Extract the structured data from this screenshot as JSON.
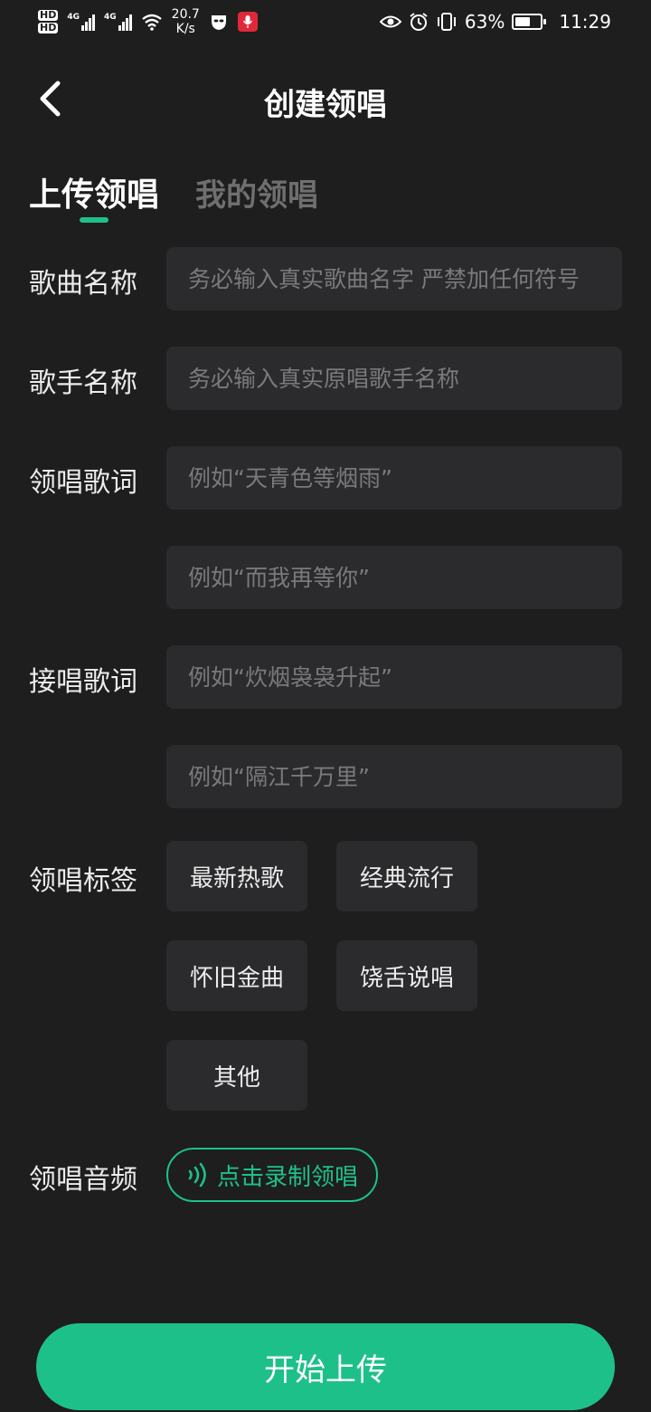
{
  "status_bar": {
    "hd1": "HD",
    "hd2": "HD",
    "signal1_label": "4G",
    "signal2_label": "4G",
    "net_speed": "20.7",
    "net_unit": "K/s",
    "battery_percent": "63%",
    "battery_level": 0.63,
    "time": "11:29"
  },
  "header": {
    "title": "创建领唱"
  },
  "tabs": [
    {
      "label": "上传领唱",
      "active": true
    },
    {
      "label": "我的领唱",
      "active": false
    }
  ],
  "form": {
    "song_name": {
      "label": "歌曲名称",
      "placeholder": "务必输入真实歌曲名字 严禁加任何符号",
      "value": ""
    },
    "singer_name": {
      "label": "歌手名称",
      "placeholder": "务必输入真实原唱歌手名称",
      "value": ""
    },
    "lead_lyrics": {
      "label": "领唱歌词",
      "placeholder1": "例如“天青色等烟雨”",
      "placeholder2": "例如“而我再等你”"
    },
    "follow_lyrics": {
      "label": "接唱歌词",
      "placeholder1": "例如“炊烟袅袅升起”",
      "placeholder2": "例如“隔江千万里”"
    },
    "tags": {
      "label": "领唱标签",
      "items": [
        "最新热歌",
        "经典流行",
        "怀旧金曲",
        "饶舌说唱",
        "其他"
      ]
    },
    "audio": {
      "label": "领唱音频",
      "button": "点击录制领唱"
    }
  },
  "upload_button": "开始上传",
  "colors": {
    "accent": "#1ec089",
    "background": "#1e1e1f",
    "field": "#2b2b2d"
  }
}
